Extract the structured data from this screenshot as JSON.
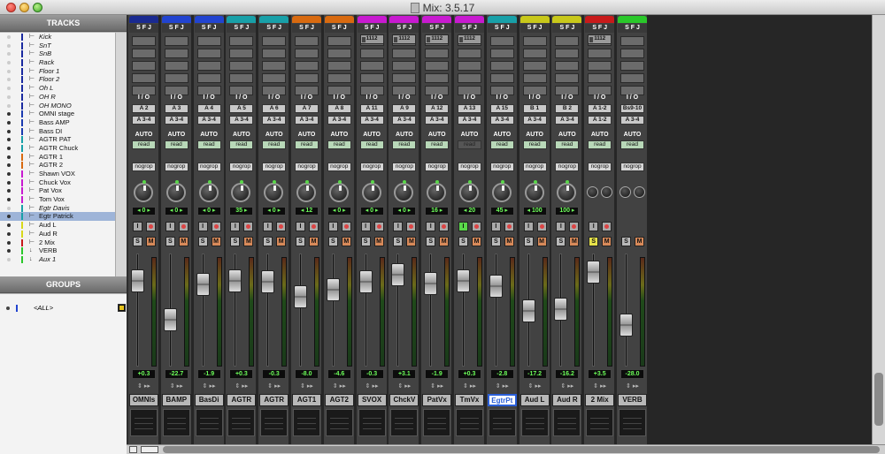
{
  "window": {
    "title": "Mix: 3.5.17"
  },
  "panels": {
    "tracks_title": "TRACKS",
    "groups_title": "GROUPS",
    "group_item": "<ALL>"
  },
  "track_list": [
    {
      "name": "Kick",
      "color": "#1a2aa0",
      "italic": true,
      "dot": "light"
    },
    {
      "name": "SnT",
      "color": "#1a2aa0",
      "italic": true,
      "dot": "light"
    },
    {
      "name": "SnB",
      "color": "#1a2aa0",
      "italic": true,
      "dot": "light"
    },
    {
      "name": "Rack",
      "color": "#1a2aa0",
      "italic": true,
      "dot": "light"
    },
    {
      "name": "Floor 1",
      "color": "#1a2aa0",
      "italic": true,
      "dot": "light"
    },
    {
      "name": "Floor 2",
      "color": "#1a2aa0",
      "italic": true,
      "dot": "light"
    },
    {
      "name": "Oh L",
      "color": "#1a2aa0",
      "italic": true,
      "dot": "light"
    },
    {
      "name": "OH R",
      "color": "#1a2aa0",
      "italic": true,
      "dot": "light"
    },
    {
      "name": "OH MONO",
      "color": "#1a2aa0",
      "italic": true,
      "dot": "light"
    },
    {
      "name": "OMNI stage",
      "color": "#1a3ab0",
      "italic": false,
      "dot": "dark"
    },
    {
      "name": "Bass AMP",
      "color": "#1a3ab0",
      "italic": false,
      "dot": "dark"
    },
    {
      "name": "Bass DI",
      "color": "#1a3ab0",
      "italic": false,
      "dot": "dark"
    },
    {
      "name": "AGTR PAT",
      "color": "#18a0a8",
      "italic": false,
      "dot": "dark"
    },
    {
      "name": "AGTR Chuck",
      "color": "#18a0a8",
      "italic": false,
      "dot": "dark"
    },
    {
      "name": "AGTR  1",
      "color": "#d86a10",
      "italic": false,
      "dot": "dark"
    },
    {
      "name": "AGTR  2",
      "color": "#d86a10",
      "italic": false,
      "dot": "dark"
    },
    {
      "name": "Shawn VOX",
      "color": "#c81ad0",
      "italic": false,
      "dot": "dark"
    },
    {
      "name": "Chuck Vox",
      "color": "#c81ad0",
      "italic": false,
      "dot": "dark"
    },
    {
      "name": "Pat Vox",
      "color": "#c81ad0",
      "italic": false,
      "dot": "dark"
    },
    {
      "name": "Tom Vox",
      "color": "#c81ad0",
      "italic": false,
      "dot": "dark"
    },
    {
      "name": "Egtr Davis",
      "color": "#18a0a8",
      "italic": true,
      "dot": "light"
    },
    {
      "name": "Egtr Patrick",
      "color": "#18a0a8",
      "italic": false,
      "dot": "dark",
      "selected": true
    },
    {
      "name": "Aud L",
      "color": "#d8d81a",
      "italic": false,
      "dot": "dark"
    },
    {
      "name": "Aud R",
      "color": "#d8d81a",
      "italic": false,
      "dot": "dark"
    },
    {
      "name": "2 Mix",
      "color": "#c81a1a",
      "italic": false,
      "dot": "dark"
    },
    {
      "name": "VERB",
      "color": "#2ac82a",
      "italic": false,
      "dot": "dark",
      "icon": "arrow"
    },
    {
      "name": "Aux 1",
      "color": "#2ac82a",
      "italic": true,
      "dot": "light",
      "icon": "arrow"
    }
  ],
  "strips": [
    {
      "name": "OMNIs",
      "color": "#1a2a90",
      "sends": [],
      "in": "A 2",
      "out": "A 3-4",
      "auto": "read",
      "pan": "◂ 0 ▸",
      "vol": "+0.3",
      "fader": 0.18,
      "knob": "normal"
    },
    {
      "name": "BAMP",
      "color": "#2244d0",
      "sends": [],
      "in": "A 3",
      "out": "A 3-4",
      "auto": "read",
      "pan": "◂ 0 ▸",
      "vol": "-22.7",
      "fader": 0.62,
      "knob": "normal"
    },
    {
      "name": "BasDi",
      "color": "#2244d0",
      "sends": [],
      "in": "A 4",
      "out": "A 3-4",
      "auto": "read",
      "pan": "◂ 0 ▸",
      "vol": "-1.9",
      "fader": 0.22,
      "knob": "normal"
    },
    {
      "name": "AGTR",
      "color": "#18a0a8",
      "sends": [],
      "in": "A 5",
      "out": "A 3-4",
      "auto": "read",
      "pan": "35 ▸",
      "vol": "+0.3",
      "fader": 0.18,
      "knob": "normal"
    },
    {
      "name": "AGTR",
      "color": "#18a0a8",
      "sends": [],
      "in": "A 6",
      "out": "A 3-4",
      "auto": "read",
      "pan": "◂ 0 ▸",
      "vol": "-0.3",
      "fader": 0.19,
      "knob": "normal"
    },
    {
      "name": "AGT1",
      "color": "#d86a10",
      "sends": [],
      "in": "A 7",
      "out": "A 3-4",
      "auto": "read",
      "pan": "◂ 12",
      "vol": "-8.0",
      "fader": 0.36,
      "knob": "normal"
    },
    {
      "name": "AGT2",
      "color": "#d86a10",
      "sends": [],
      "in": "A 8",
      "out": "A 3-4",
      "auto": "read",
      "pan": "◂ 0 ▸",
      "vol": "-4.6",
      "fader": 0.28,
      "knob": "normal"
    },
    {
      "name": "SVOX",
      "color": "#c81ad0",
      "sends": [
        "1112"
      ],
      "in": "A 11",
      "out": "A 3-4",
      "auto": "read",
      "pan": "◂ 0 ▸",
      "vol": "-0.3",
      "fader": 0.19,
      "knob": "normal"
    },
    {
      "name": "ChckV",
      "color": "#c81ad0",
      "sends": [
        "1112"
      ],
      "in": "A 9",
      "out": "A 3-4",
      "auto": "read",
      "pan": "◂ 0 ▸",
      "vol": "+3.1",
      "fader": 0.11,
      "knob": "normal"
    },
    {
      "name": "PatVx",
      "color": "#c81ad0",
      "sends": [
        "1112"
      ],
      "in": "A 12",
      "out": "A 3-4",
      "auto": "read",
      "pan": "16 ▸",
      "vol": "-1.9",
      "fader": 0.21,
      "knob": "normal"
    },
    {
      "name": "TmVx",
      "color": "#c81ad0",
      "sends": [
        "1112"
      ],
      "in": "A 13",
      "out": "A 3-4",
      "auto": "read",
      "pan": "◂ 20",
      "vol": "+0.3",
      "fader": 0.18,
      "knob": "normal",
      "input_on": true,
      "read_dark": true
    },
    {
      "name": "EgtrPt",
      "color": "#18a0a8",
      "sends": [],
      "in": "A 15",
      "out": "A 3-4",
      "auto": "read",
      "pan": "45 ▸",
      "vol": "-2.8",
      "fader": 0.24,
      "knob": "normal",
      "selected": true
    },
    {
      "name": "Aud L",
      "color": "#c8c81a",
      "sends": [],
      "in": "B 1",
      "out": "A 3-4",
      "auto": "read",
      "pan": "◂ 100",
      "vol": "-17.2",
      "fader": 0.52,
      "knob": "normal"
    },
    {
      "name": "Aud R",
      "color": "#c8c81a",
      "sends": [],
      "in": "B 2",
      "out": "A 3-4",
      "auto": "read",
      "pan": "100 ▸",
      "vol": "-16.2",
      "fader": 0.5,
      "knob": "normal"
    },
    {
      "name": "2 Mix",
      "color": "#c81a1a",
      "sends": [
        "1112"
      ],
      "in": "A 1-2",
      "out": "A 1-2",
      "auto": "read",
      "pan": "",
      "vol": "+3.5",
      "fader": 0.08,
      "knob": "stereo",
      "solo_on": true
    },
    {
      "name": "VERB",
      "color": "#2ac82a",
      "sends": [],
      "in": "Bs9-10",
      "out": "A 3-4",
      "auto": "read",
      "pan": "",
      "vol": "-28.0",
      "fader": 0.68,
      "knob": "stereo",
      "no_input": true
    }
  ],
  "labels": {
    "sfj": "S F J",
    "io": "I / O",
    "auto": "AUTO",
    "group": "nogrop",
    "solo": "S",
    "mute": "M",
    "input": "I"
  }
}
